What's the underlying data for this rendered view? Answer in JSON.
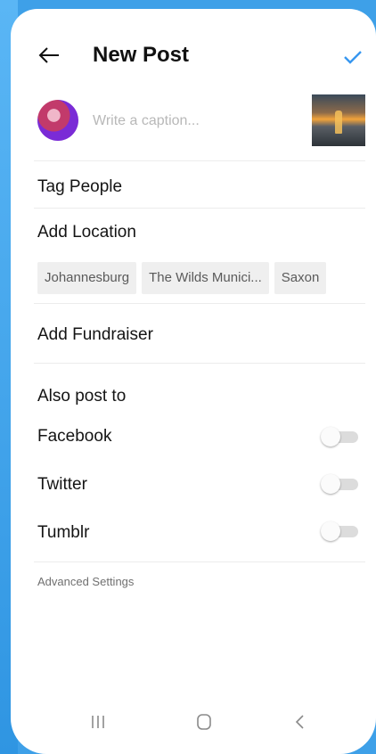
{
  "header": {
    "title": "New Post",
    "back_icon": "arrow-left-icon",
    "confirm_icon": "check-icon",
    "accent_color": "#3897f0"
  },
  "caption": {
    "placeholder": "Write a caption...",
    "value": ""
  },
  "rows": {
    "tag_people": "Tag People",
    "add_location": "Add Location",
    "add_fundraiser": "Add Fundraiser"
  },
  "location_suggestions": [
    "Johannesburg",
    "The Wilds Munici...",
    "Saxon"
  ],
  "share": {
    "heading": "Also post to",
    "targets": [
      {
        "label": "Facebook",
        "enabled": false
      },
      {
        "label": "Twitter",
        "enabled": false
      },
      {
        "label": "Tumblr",
        "enabled": false
      }
    ]
  },
  "advanced_settings": "Advanced Settings",
  "navbar": {
    "recent_icon": "recent-apps-icon",
    "home_icon": "home-icon",
    "back_icon": "back-chevron-icon"
  }
}
